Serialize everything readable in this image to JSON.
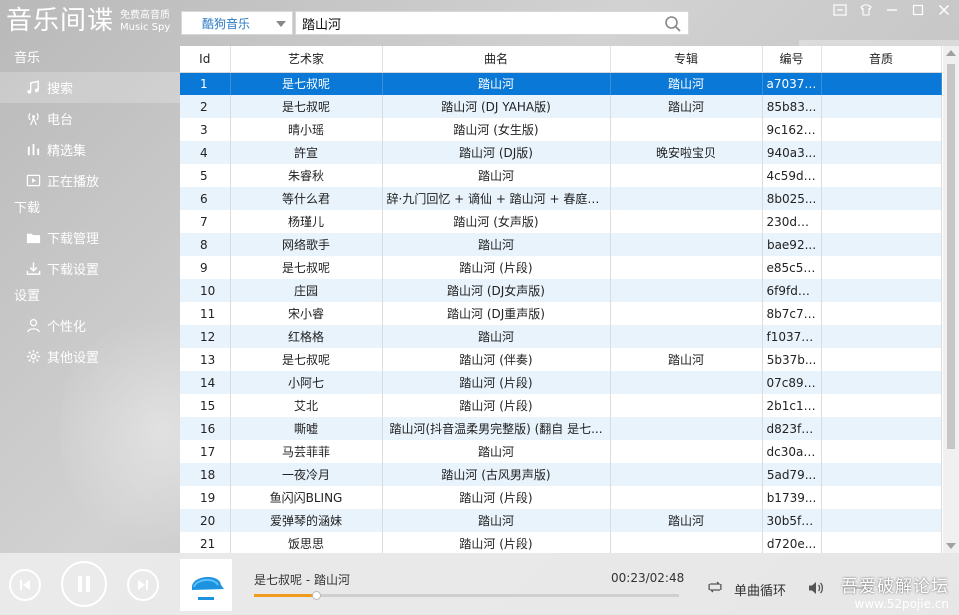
{
  "app": {
    "title": "音乐间谍",
    "subtitle_line1": "免费高音质",
    "subtitle_line2": "Music Spy"
  },
  "topbar": {
    "source_selected": "酷狗音乐",
    "search_value": "踏山河"
  },
  "sidebar": {
    "sections": [
      {
        "heading": "音乐",
        "items": [
          {
            "label": "搜索",
            "icon": "music-note-icon",
            "active": true
          },
          {
            "label": "电台",
            "icon": "radio-icon",
            "active": false
          },
          {
            "label": "精选集",
            "icon": "chart-bars-icon",
            "active": false
          },
          {
            "label": "正在播放",
            "icon": "now-playing-icon",
            "active": false
          }
        ]
      },
      {
        "heading": "下载",
        "items": [
          {
            "label": "下载管理",
            "icon": "folder-icon",
            "active": false
          },
          {
            "label": "下载设置",
            "icon": "download-icon",
            "active": false
          }
        ]
      },
      {
        "heading": "设置",
        "items": [
          {
            "label": "个性化",
            "icon": "user-icon",
            "active": false
          },
          {
            "label": "其他设置",
            "icon": "gear-icon",
            "active": false
          }
        ]
      }
    ]
  },
  "table": {
    "columns": [
      "Id",
      "艺术家",
      "曲名",
      "专辑",
      "编号",
      "音质"
    ],
    "selected_index": 0,
    "rows": [
      [
        "1",
        "是七叔呢",
        "踏山河",
        "踏山河",
        "a70372...",
        ""
      ],
      [
        "2",
        "是七叔呢",
        "踏山河 (DJ YAHA版)",
        "踏山河",
        "85b83...",
        ""
      ],
      [
        "3",
        "晴小瑶",
        "踏山河 (女生版)",
        "",
        "9c162f...",
        ""
      ],
      [
        "4",
        "許宣",
        "踏山河 (DJ版)",
        "晚安啦宝贝",
        "940a3...",
        ""
      ],
      [
        "5",
        "朱睿秋",
        "踏山河",
        "",
        "4c59d1...",
        ""
      ],
      [
        "6",
        "等什么君",
        "辞·九门回忆 + 谪仙 + 踏山河 + 春庭雪...",
        "",
        "8b025...",
        ""
      ],
      [
        "7",
        "杨瑾儿",
        "踏山河 (女声版)",
        "",
        "230d6c...",
        ""
      ],
      [
        "8",
        "网络歌手",
        "踏山河",
        "",
        "bae92...",
        ""
      ],
      [
        "9",
        "是七叔呢",
        "踏山河 (片段)",
        "",
        "e85c57...",
        ""
      ],
      [
        "10",
        "庄园",
        "踏山河 (DJ女声版)",
        "",
        "6f9fd1...",
        ""
      ],
      [
        "11",
        "宋小睿",
        "踏山河 (DJ重声版)",
        "",
        "8b7c7e...",
        ""
      ],
      [
        "12",
        "红格格",
        "踏山河",
        "",
        "f1037a...",
        ""
      ],
      [
        "13",
        "是七叔呢",
        "踏山河 (伴奏)",
        "踏山河",
        "5b37b...",
        ""
      ],
      [
        "14",
        "小阿七",
        "踏山河 (片段)",
        "",
        "07c89a...",
        ""
      ],
      [
        "15",
        "艾北",
        "踏山河 (片段)",
        "",
        "2b1c14...",
        ""
      ],
      [
        "16",
        "嘶嘘",
        "踏山河(抖音温柔男完整版) (翻自 是七...",
        "",
        "d823fd...",
        ""
      ],
      [
        "17",
        "马芸菲菲",
        "踏山河",
        "",
        "dc30a9...",
        ""
      ],
      [
        "18",
        "一夜冷月",
        "踏山河 (古风男声版)",
        "",
        "5ad79...",
        ""
      ],
      [
        "19",
        "鱼闪闪BLING",
        "踏山河 (片段)",
        "",
        "b1739...",
        ""
      ],
      [
        "20",
        "爱弹琴的涵妹",
        "踏山河",
        "踏山河",
        "30b5f0...",
        ""
      ],
      [
        "21",
        "饭思思",
        "踏山河 (片段)",
        "",
        "d720e...",
        ""
      ]
    ]
  },
  "player": {
    "now_playing": "是七叔呢 - 踏山河",
    "time": "00:23/02:48",
    "progress_fraction": 0.146,
    "mode_label": "单曲循环",
    "accent": "#f29b1c"
  },
  "watermark": {
    "line1": "吾爱破解论坛",
    "line2": "www.52pojie.cn"
  },
  "colors": {
    "selected_row": "#0a78d7",
    "alt_row": "#e8f3fc",
    "source_text": "#2a79c6"
  }
}
